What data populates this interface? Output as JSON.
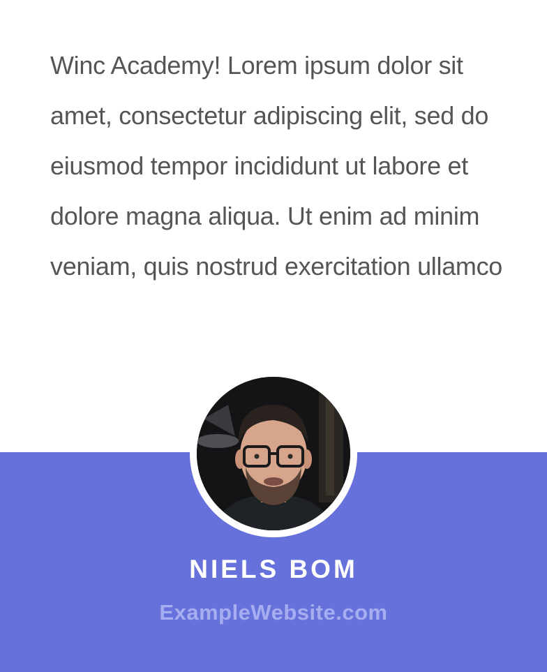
{
  "testimonial": {
    "quote": "Winc Academy! Lorem ipsum dolor sit amet, consectetur adipiscing elit, sed do eiusmod tempor incididunt ut labore et dolore magna aliqua. Ut enim ad minim veniam, quis nostrud exercitation ullamco"
  },
  "author": {
    "name": "NIELS BOM",
    "website": "ExampleWebsite.com",
    "avatar_icon": "person-photo-icon"
  },
  "colors": {
    "footer_background": "#6771db",
    "quote_text": "#555557",
    "name_text": "#ffffff",
    "website_text": "#a7aef0"
  }
}
